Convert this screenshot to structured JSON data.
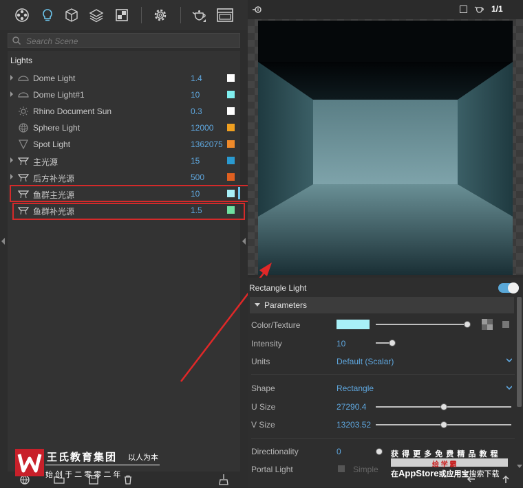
{
  "toolbar": {
    "icons": [
      "environment-icon",
      "light-bulb-icon",
      "cube-icon",
      "layers-icon",
      "texture-icon",
      "gear-icon",
      "teapot-icon",
      "render-window-icon"
    ]
  },
  "search": {
    "placeholder": "Search Scene"
  },
  "lights": {
    "section_title": "Lights",
    "items": [
      {
        "name": "Dome Light",
        "value": "1.4",
        "color": "#ffffff",
        "has_arrow": true,
        "icon": "dome-light-icon"
      },
      {
        "name": "Dome Light#1",
        "value": "10",
        "color": "#7fefef",
        "has_arrow": true,
        "icon": "dome-light-icon"
      },
      {
        "name": "Rhino Document Sun",
        "value": "0.3",
        "color": "#ffffff",
        "has_arrow": false,
        "icon": "sun-icon"
      },
      {
        "name": "Sphere Light",
        "value": "12000",
        "color": "#f0a020",
        "has_arrow": false,
        "icon": "sphere-light-icon"
      },
      {
        "name": "Spot Light",
        "value": "1362075",
        "color": "#f08a2a",
        "has_arrow": false,
        "icon": "spot-light-icon"
      },
      {
        "name": "主光源",
        "value": "15",
        "color": "#2a9ad0",
        "has_arrow": true,
        "icon": "rectangle-light-icon"
      },
      {
        "name": "后方补光源",
        "value": "500",
        "color": "#e06020",
        "has_arrow": true,
        "icon": "rectangle-light-icon"
      },
      {
        "name": "鱼群主光源",
        "value": "10",
        "color": "#a8f0f8",
        "has_arrow": false,
        "icon": "rectangle-light-icon"
      },
      {
        "name": "鱼群补光源",
        "value": "1.5",
        "color": "#70e0a0",
        "has_arrow": false,
        "icon": "rectangle-light-icon"
      }
    ]
  },
  "viewport_top": {
    "counter": "1/1"
  },
  "properties": {
    "title": "Rectangle Light",
    "enabled": true,
    "group_label": "Parameters",
    "color_texture_label": "Color/Texture",
    "color_value": "#a8f0f8",
    "intensity_label": "Intensity",
    "intensity_value": "10",
    "units_label": "Units",
    "units_value": "Default (Scalar)",
    "shape_label": "Shape",
    "shape_value": "Rectangle",
    "u_size_label": "U Size",
    "u_size_value": "27290.4",
    "v_size_label": "V Size",
    "v_size_value": "13203.52",
    "directionality_label": "Directionality",
    "directionality_value": "0",
    "portal_light_label": "Portal Light",
    "simple_label": "Simple"
  },
  "watermark_left": {
    "company": "王氏教育集团",
    "motto": "以人为本",
    "since": "始 创 于 二 零 零 二 年"
  },
  "watermark_right": {
    "line1": "获 得 更 多 免 费 精 品 教 程",
    "badge": "绘 学 霸",
    "line2_prefix": "在",
    "line2_app": "AppStore",
    "line2_mid": "或应用宝",
    "line2_suffix": "搜索下载"
  }
}
